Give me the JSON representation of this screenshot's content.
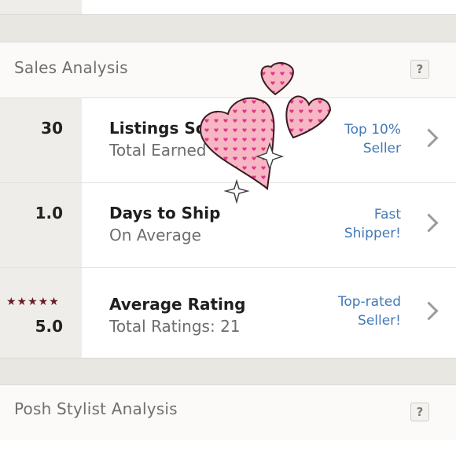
{
  "sales_analysis": {
    "title": "Sales Analysis",
    "help": "?",
    "rows": [
      {
        "value": "30",
        "title": "Listings Sold",
        "subtitle": "Total Earned",
        "badge_line1": "Top 10%",
        "badge_line2": "Seller"
      },
      {
        "value": "1.0",
        "title": "Days to Ship",
        "subtitle": "On Average",
        "badge_line1": "Fast",
        "badge_line2": "Shipper!"
      },
      {
        "value": "5.0",
        "stars": "★★★★★",
        "title": "Average Rating",
        "subtitle": "Total Ratings: 21",
        "badge_line1": "Top-rated",
        "badge_line2": "Seller!"
      }
    ]
  },
  "posh_stylist_analysis": {
    "title": "Posh Stylist Analysis",
    "help": "?"
  },
  "colors": {
    "badge_text": "#4479b6",
    "star_color": "#6b1a25",
    "heart_pink": "#f5a8b5",
    "heart_dots": "#e0388a"
  },
  "icons": [
    "help-icon",
    "chevron-right-icon",
    "star-icon",
    "heart-sticker",
    "sparkle-icon"
  ]
}
